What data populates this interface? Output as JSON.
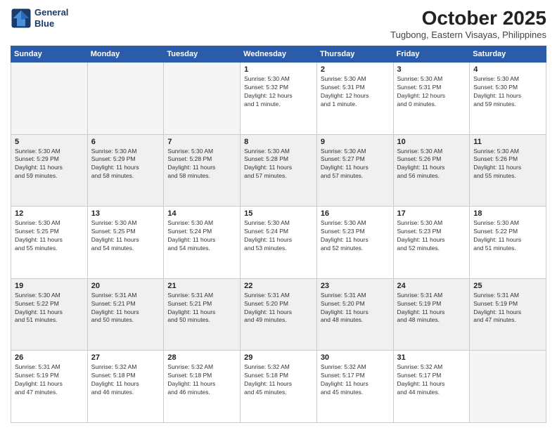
{
  "logo": {
    "line1": "General",
    "line2": "Blue"
  },
  "title": "October 2025",
  "location": "Tugbong, Eastern Visayas, Philippines",
  "weekdays": [
    "Sunday",
    "Monday",
    "Tuesday",
    "Wednesday",
    "Thursday",
    "Friday",
    "Saturday"
  ],
  "weeks": [
    [
      {
        "day": "",
        "info": ""
      },
      {
        "day": "",
        "info": ""
      },
      {
        "day": "",
        "info": ""
      },
      {
        "day": "1",
        "info": "Sunrise: 5:30 AM\nSunset: 5:32 PM\nDaylight: 12 hours\nand 1 minute."
      },
      {
        "day": "2",
        "info": "Sunrise: 5:30 AM\nSunset: 5:31 PM\nDaylight: 12 hours\nand 1 minute."
      },
      {
        "day": "3",
        "info": "Sunrise: 5:30 AM\nSunset: 5:31 PM\nDaylight: 12 hours\nand 0 minutes."
      },
      {
        "day": "4",
        "info": "Sunrise: 5:30 AM\nSunset: 5:30 PM\nDaylight: 11 hours\nand 59 minutes."
      }
    ],
    [
      {
        "day": "5",
        "info": "Sunrise: 5:30 AM\nSunset: 5:29 PM\nDaylight: 11 hours\nand 59 minutes."
      },
      {
        "day": "6",
        "info": "Sunrise: 5:30 AM\nSunset: 5:29 PM\nDaylight: 11 hours\nand 58 minutes."
      },
      {
        "day": "7",
        "info": "Sunrise: 5:30 AM\nSunset: 5:28 PM\nDaylight: 11 hours\nand 58 minutes."
      },
      {
        "day": "8",
        "info": "Sunrise: 5:30 AM\nSunset: 5:28 PM\nDaylight: 11 hours\nand 57 minutes."
      },
      {
        "day": "9",
        "info": "Sunrise: 5:30 AM\nSunset: 5:27 PM\nDaylight: 11 hours\nand 57 minutes."
      },
      {
        "day": "10",
        "info": "Sunrise: 5:30 AM\nSunset: 5:26 PM\nDaylight: 11 hours\nand 56 minutes."
      },
      {
        "day": "11",
        "info": "Sunrise: 5:30 AM\nSunset: 5:26 PM\nDaylight: 11 hours\nand 55 minutes."
      }
    ],
    [
      {
        "day": "12",
        "info": "Sunrise: 5:30 AM\nSunset: 5:25 PM\nDaylight: 11 hours\nand 55 minutes."
      },
      {
        "day": "13",
        "info": "Sunrise: 5:30 AM\nSunset: 5:25 PM\nDaylight: 11 hours\nand 54 minutes."
      },
      {
        "day": "14",
        "info": "Sunrise: 5:30 AM\nSunset: 5:24 PM\nDaylight: 11 hours\nand 54 minutes."
      },
      {
        "day": "15",
        "info": "Sunrise: 5:30 AM\nSunset: 5:24 PM\nDaylight: 11 hours\nand 53 minutes."
      },
      {
        "day": "16",
        "info": "Sunrise: 5:30 AM\nSunset: 5:23 PM\nDaylight: 11 hours\nand 52 minutes."
      },
      {
        "day": "17",
        "info": "Sunrise: 5:30 AM\nSunset: 5:23 PM\nDaylight: 11 hours\nand 52 minutes."
      },
      {
        "day": "18",
        "info": "Sunrise: 5:30 AM\nSunset: 5:22 PM\nDaylight: 11 hours\nand 51 minutes."
      }
    ],
    [
      {
        "day": "19",
        "info": "Sunrise: 5:30 AM\nSunset: 5:22 PM\nDaylight: 11 hours\nand 51 minutes."
      },
      {
        "day": "20",
        "info": "Sunrise: 5:31 AM\nSunset: 5:21 PM\nDaylight: 11 hours\nand 50 minutes."
      },
      {
        "day": "21",
        "info": "Sunrise: 5:31 AM\nSunset: 5:21 PM\nDaylight: 11 hours\nand 50 minutes."
      },
      {
        "day": "22",
        "info": "Sunrise: 5:31 AM\nSunset: 5:20 PM\nDaylight: 11 hours\nand 49 minutes."
      },
      {
        "day": "23",
        "info": "Sunrise: 5:31 AM\nSunset: 5:20 PM\nDaylight: 11 hours\nand 48 minutes."
      },
      {
        "day": "24",
        "info": "Sunrise: 5:31 AM\nSunset: 5:19 PM\nDaylight: 11 hours\nand 48 minutes."
      },
      {
        "day": "25",
        "info": "Sunrise: 5:31 AM\nSunset: 5:19 PM\nDaylight: 11 hours\nand 47 minutes."
      }
    ],
    [
      {
        "day": "26",
        "info": "Sunrise: 5:31 AM\nSunset: 5:19 PM\nDaylight: 11 hours\nand 47 minutes."
      },
      {
        "day": "27",
        "info": "Sunrise: 5:32 AM\nSunset: 5:18 PM\nDaylight: 11 hours\nand 46 minutes."
      },
      {
        "day": "28",
        "info": "Sunrise: 5:32 AM\nSunset: 5:18 PM\nDaylight: 11 hours\nand 46 minutes."
      },
      {
        "day": "29",
        "info": "Sunrise: 5:32 AM\nSunset: 5:18 PM\nDaylight: 11 hours\nand 45 minutes."
      },
      {
        "day": "30",
        "info": "Sunrise: 5:32 AM\nSunset: 5:17 PM\nDaylight: 11 hours\nand 45 minutes."
      },
      {
        "day": "31",
        "info": "Sunrise: 5:32 AM\nSunset: 5:17 PM\nDaylight: 11 hours\nand 44 minutes."
      },
      {
        "day": "",
        "info": ""
      }
    ]
  ]
}
